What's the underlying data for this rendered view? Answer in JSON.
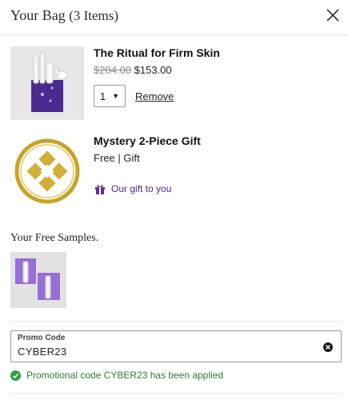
{
  "header": {
    "title": "Your Bag",
    "item_count": "(3 Items)",
    "close_icon": "close-icon"
  },
  "items": [
    {
      "name": "The Ritual for Firm Skin",
      "original_price": "$204.00",
      "price": "$153.00",
      "quantity": "1",
      "remove_label": "Remove"
    },
    {
      "name": "Mystery 2-Piece Gift",
      "price_note": "Free | Gift",
      "gift_label": "Our gift to you",
      "gift_icon": "gift-icon"
    }
  ],
  "samples": {
    "title": "Your Free Samples."
  },
  "promo": {
    "label": "Promo Code",
    "value": "CYBER23",
    "clear_icon": "clear-icon",
    "status_icon": "check-circle-icon",
    "status_message": "Promotional code CYBER23 has been applied"
  },
  "colors": {
    "gift_purple": "#4a2a8a",
    "success_green": "#2e7d32",
    "product_purple": "#4b2a8f",
    "gold": "#c9a227"
  }
}
